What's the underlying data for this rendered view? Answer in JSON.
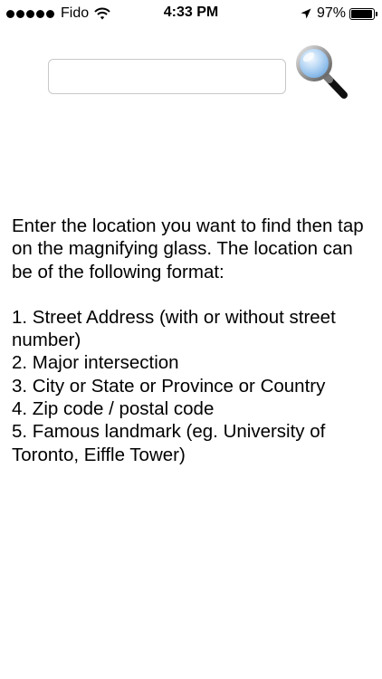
{
  "status_bar": {
    "carrier": "Fido",
    "time": "4:33 PM",
    "battery_percent": "97%",
    "battery_level": 0.97,
    "icons": [
      "signal-dots-icon",
      "wifi-icon",
      "location-arrow-icon",
      "battery-icon"
    ]
  },
  "search": {
    "value": "",
    "placeholder": "",
    "button_icon": "magnifying-glass-icon"
  },
  "instructions": {
    "intro": "Enter the location you want to find then tap on the magnifying glass. The location can be of the following format:",
    "items": [
      "1.  Street Address (with or without street number)",
      "2.  Major intersection",
      "3.  City or State or Province or Country",
      "4.  Zip code / postal code",
      "5.  Famous landmark (eg. University of Toronto, Eiffle Tower)"
    ]
  },
  "colors": {
    "background": "#ffffff",
    "text": "#000000",
    "input_border": "#c8c8c8",
    "lens_blue": "#7ab3ea"
  }
}
